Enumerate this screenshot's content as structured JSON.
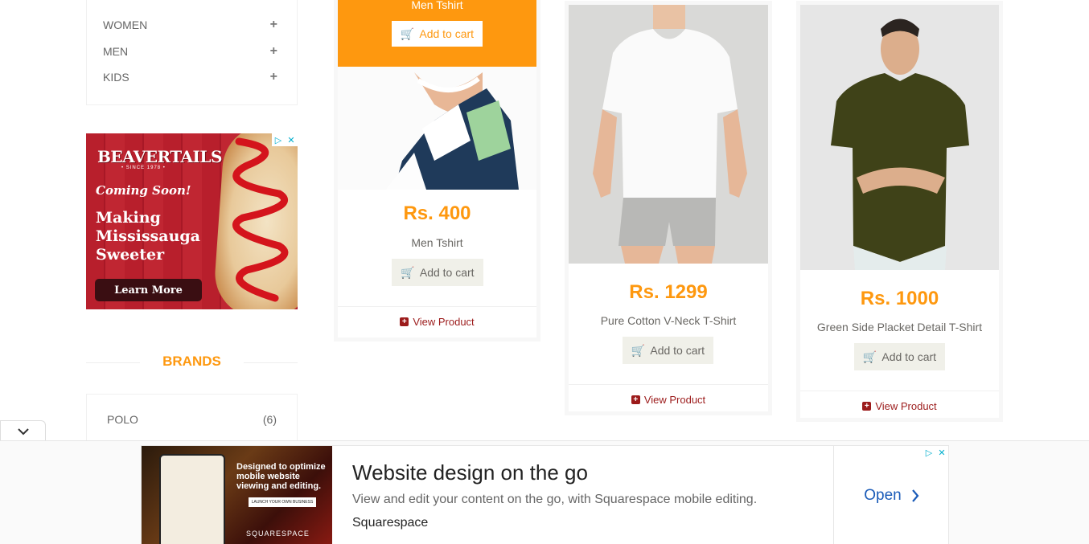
{
  "sidebar": {
    "categories": [
      {
        "label": "WOMEN"
      },
      {
        "label": "MEN"
      },
      {
        "label": "KIDS"
      }
    ],
    "ad": {
      "brand": "BEAVERTAILS",
      "since": "• SINCE 1978 •",
      "coming": "Coming Soon!",
      "headline": "Making Mississauga Sweeter",
      "cta": "Learn More"
    },
    "brands_title": "BRANDS",
    "brands": [
      {
        "name": "POLO",
        "count": "(6)"
      }
    ]
  },
  "products": [
    {
      "name": "Men Tshirt",
      "price": "Rs. 400",
      "add_to_cart": "Add to cart",
      "view": "View Product",
      "overlay_name": "Men Tshirt",
      "overlay_cart": "Add to cart"
    },
    {
      "name": "Pure Cotton V-Neck T-Shirt",
      "price": "Rs. 1299",
      "add_to_cart": "Add to cart",
      "view": "View Product"
    },
    {
      "name": "Green Side Placket Detail T-Shirt",
      "price": "Rs. 1000",
      "add_to_cart": "Add to cart",
      "view": "View Product"
    }
  ],
  "bottom_ad": {
    "thumb_text": "Designed to optimize mobile website viewing and editing.",
    "thumb_button": "LAUNCH YOUR OWN BUSINESS",
    "thumb_brand": "SQUARESPACE",
    "title": "Website design on the go",
    "description": "View and edit your content on the go, with Squarespace mobile editing.",
    "advertiser": "Squarespace",
    "cta": "Open"
  },
  "colors": {
    "accent": "#fe980f",
    "link": "#9c1b1b",
    "cta_blue": "#1a5bb8"
  }
}
